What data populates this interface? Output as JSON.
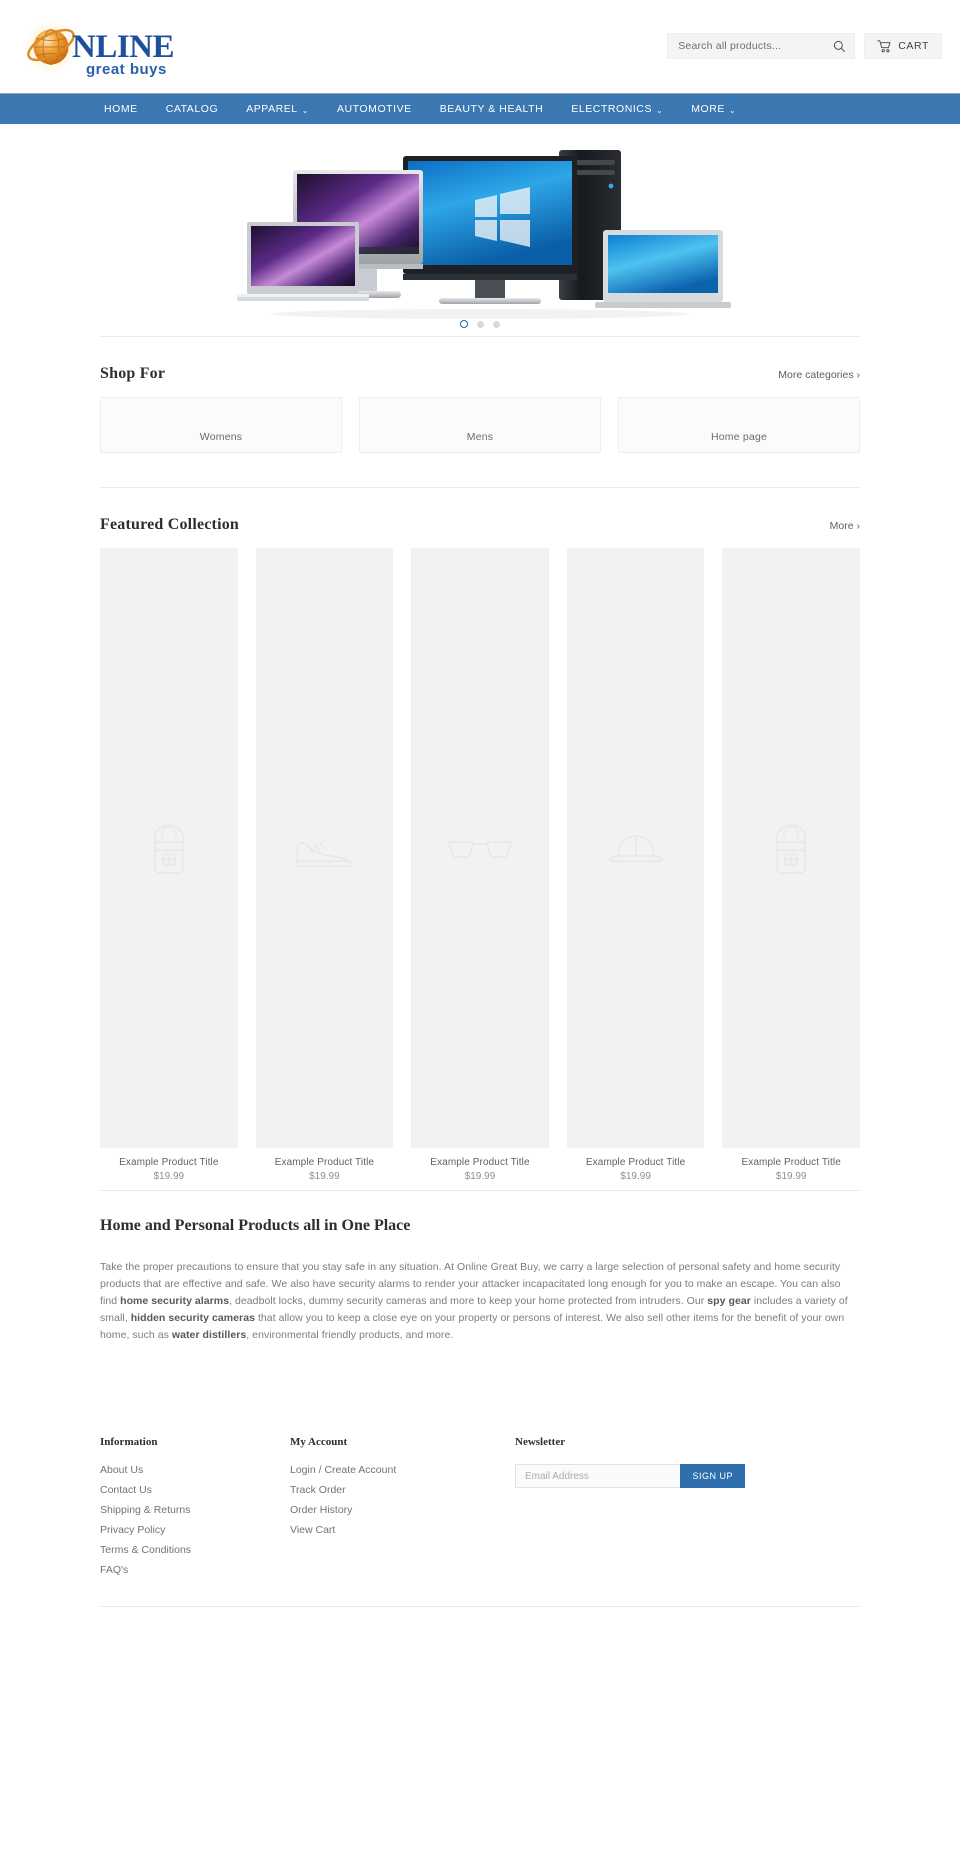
{
  "header": {
    "logo": {
      "brand_main": "NLINE",
      "brand_sub": "great buys",
      "alt": "Online Great Buys"
    },
    "search": {
      "placeholder": "Search all products...",
      "value": "",
      "icon": "search-icon"
    },
    "cart": {
      "label": "CART",
      "icon": "shopping-cart-icon"
    }
  },
  "nav": {
    "items": [
      {
        "label": "HOME",
        "has_dropdown": false
      },
      {
        "label": "CATALOG",
        "has_dropdown": false
      },
      {
        "label": "APPAREL",
        "has_dropdown": true
      },
      {
        "label": "AUTOMOTIVE",
        "has_dropdown": false
      },
      {
        "label": "BEAUTY & HEALTH",
        "has_dropdown": false
      },
      {
        "label": "ELECTRONICS",
        "has_dropdown": true
      },
      {
        "label": "MORE",
        "has_dropdown": true
      }
    ],
    "background_color": "#3b77b0"
  },
  "hero": {
    "alt": "Computer monitors, laptop, desktop tower and tablet display",
    "dots": [
      {
        "label": "1",
        "active": true
      },
      {
        "label": "2",
        "active": false
      },
      {
        "label": "3",
        "active": false
      }
    ]
  },
  "shop_for": {
    "title": "Shop For",
    "more_link": "More categories ›",
    "categories": [
      {
        "label": "Womens"
      },
      {
        "label": "Mens"
      },
      {
        "label": "Home page"
      }
    ]
  },
  "featured": {
    "title": "Featured Collection",
    "more_link": "More ›",
    "products": [
      {
        "title": "Example Product Title",
        "price": "$19.99",
        "icon": "backpack-icon"
      },
      {
        "title": "Example Product Title",
        "price": "$19.99",
        "icon": "sneaker-icon"
      },
      {
        "title": "Example Product Title",
        "price": "$19.99",
        "icon": "glasses-icon"
      },
      {
        "title": "Example Product Title",
        "price": "$19.99",
        "icon": "cap-icon"
      },
      {
        "title": "Example Product Title",
        "price": "$19.99",
        "icon": "backpack-icon"
      }
    ]
  },
  "rich_text": {
    "heading": "Home and Personal Products all in One Place",
    "paragraph_parts": [
      {
        "text": "Take the proper precautions to ensure that you stay safe in any situation. At Online Great Buy, we carry a large selection of personal safety and home security products that are effective and safe. We also have security alarms to render your attacker incapacitated long enough for you to make an escape. You can also find ",
        "bold": false
      },
      {
        "text": "home security alarms",
        "bold": true
      },
      {
        "text": ", deadbolt locks, dummy security cameras and more to keep your home protected from intruders. Our ",
        "bold": false
      },
      {
        "text": "spy gear",
        "bold": true
      },
      {
        "text": " includes a variety of small, ",
        "bold": false
      },
      {
        "text": "hidden security cameras",
        "bold": true
      },
      {
        "text": " that allow you to keep a close eye on your property or persons of interest. We also sell other items for the benefit of your own home, such as ",
        "bold": false
      },
      {
        "text": "water distillers",
        "bold": true
      },
      {
        "text": ", environmental friendly products, and more.",
        "bold": false
      }
    ]
  },
  "footer": {
    "information": {
      "title": "Information",
      "links": [
        "About Us",
        "Contact Us",
        "Shipping & Returns",
        "Privacy Policy",
        "Terms & Conditions",
        "FAQ's"
      ]
    },
    "my_account": {
      "title": "My Account",
      "links": [
        "Login / Create Account",
        "Track Order",
        "Order History",
        "View Cart"
      ]
    },
    "newsletter": {
      "title": "Newsletter",
      "placeholder": "Email Address",
      "value": "",
      "button_label": "SIGN UP",
      "button_color": "#2f6fae"
    }
  }
}
